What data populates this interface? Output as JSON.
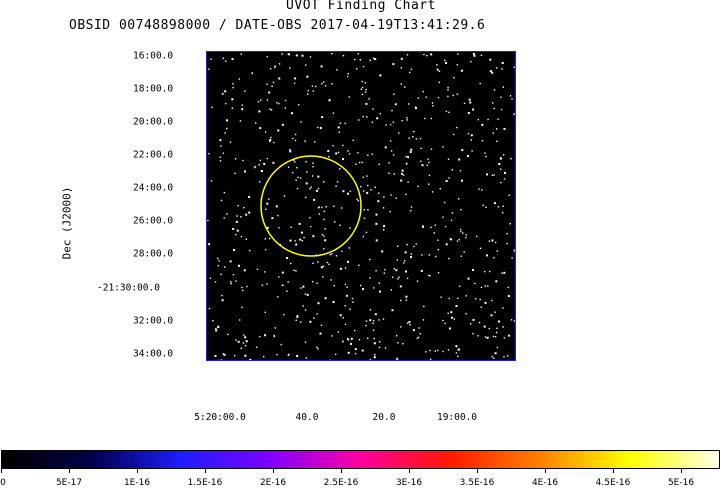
{
  "title": "UVOT Finding Chart",
  "subtitle": "OBSID 00748898000 / DATE-OBS 2017-04-19T13:41:29.6",
  "ylabel": "Dec (J2000)",
  "y_ticks": [
    "16:00.0",
    "18:00.0",
    "20:00.0",
    "22:00.0",
    "24:00.0",
    "26:00.0",
    "28:00.0",
    "-21:30:00.0",
    "32:00.0",
    "34:00.0"
  ],
  "x_ticks": [
    "5:20:00.0",
    "40.0",
    "20.0",
    "19:00.0"
  ],
  "colorbar_ticks": [
    "0",
    "5E-17",
    "1E-16",
    "1.5E-16",
    "2E-16",
    "2.5E-16",
    "3E-16",
    "3.5E-16",
    "4E-16",
    "4.5E-16",
    "5E-16"
  ],
  "colors": {
    "frame": "#1a1aff",
    "circle": "#ffff00",
    "background": "#000000",
    "stars": "#ffffff"
  },
  "colorbar_gradient": [
    "#000000",
    "#00004a",
    "#1e1eff",
    "#8000ff",
    "#ff00a0",
    "#ff1a00",
    "#ff8000",
    "#ffff00",
    "#ffffe8"
  ]
}
